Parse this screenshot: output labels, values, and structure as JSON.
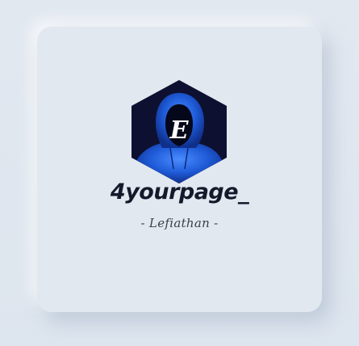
{
  "card": {
    "logo": {
      "icon": "hooded-figure-icon",
      "monogram": "E",
      "colors": {
        "hexagon": "#0d1030",
        "hood": "#1f5bd8",
        "hood_highlight": "#4a8cff"
      }
    },
    "brand_name": "4yourpage_",
    "tagline": "- Lefiathan -"
  },
  "colors": {
    "background": "#dfe6ee",
    "card": "#e2e8ef",
    "text_dark": "#141a2b"
  }
}
